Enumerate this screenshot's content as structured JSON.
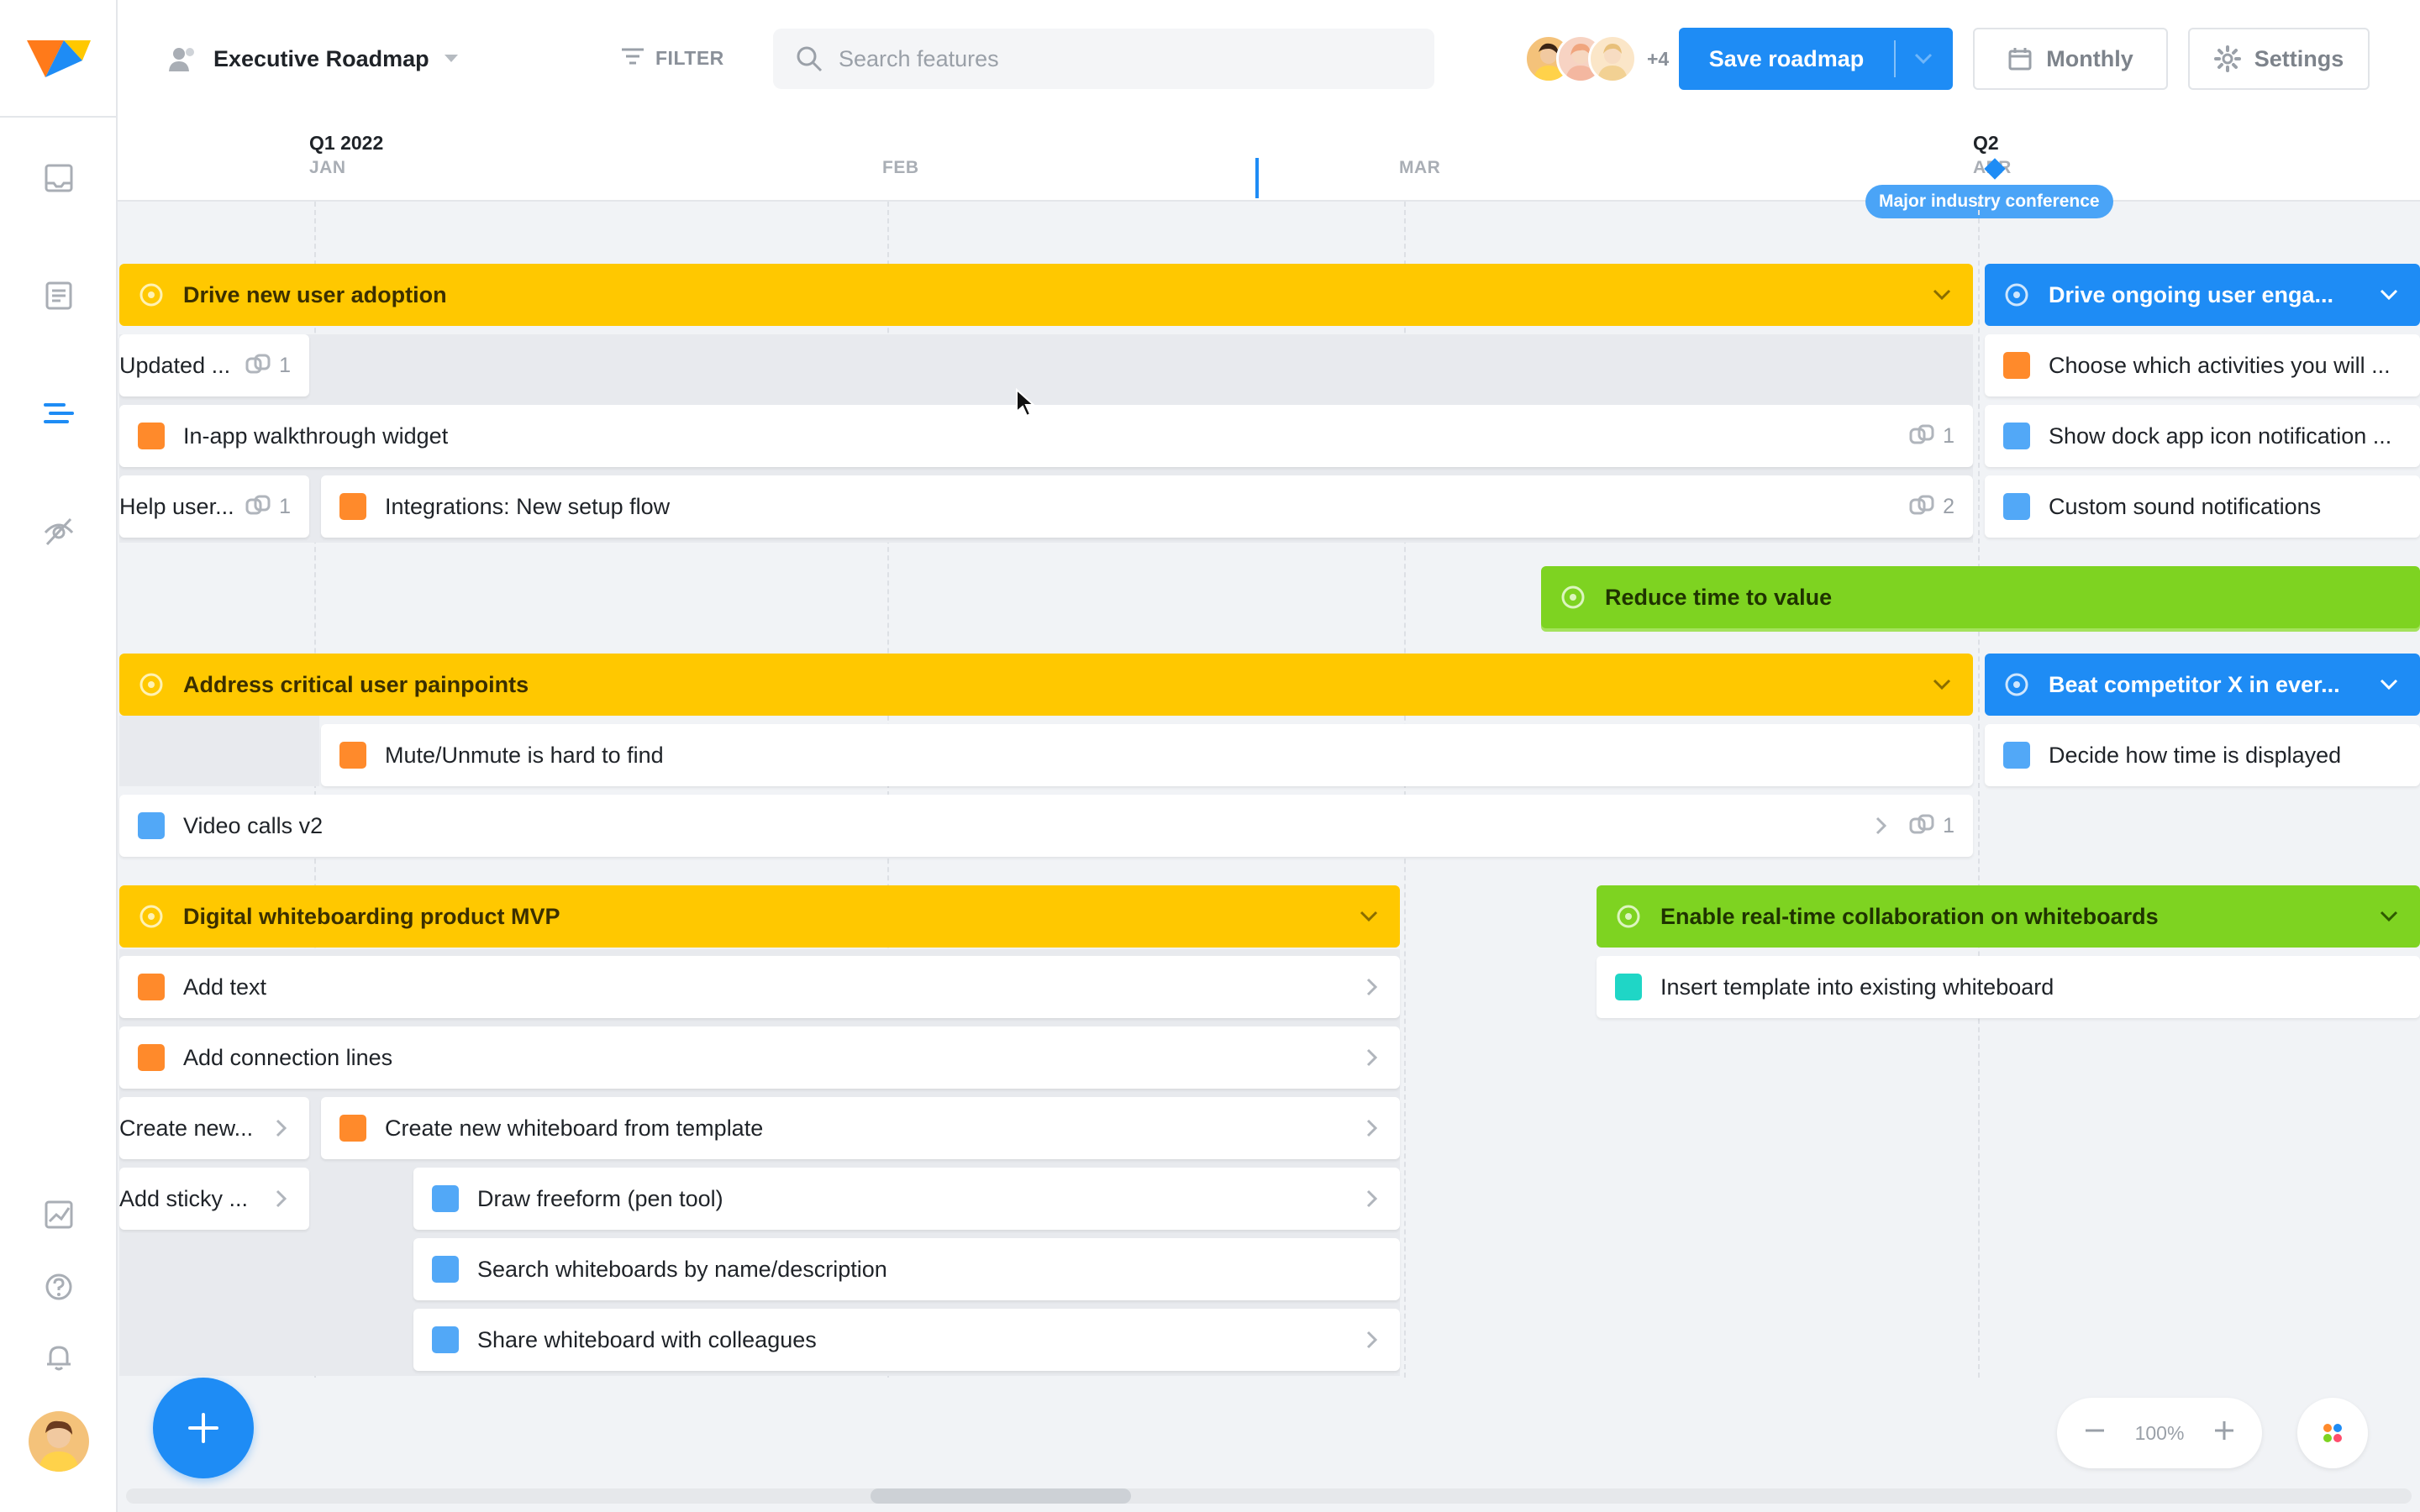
{
  "app": {
    "roadmap_name": "Executive Roadmap",
    "filter_label": "FILTER",
    "search_placeholder": "Search features",
    "avatars_more": "+4",
    "save_label": "Save roadmap",
    "view_label": "Monthly",
    "settings_label": "Settings",
    "accent_color": "#1e8cf5"
  },
  "sidebar": {
    "icons": [
      "logo-icon",
      "inbox-icon",
      "document-icon",
      "roadmap-icon",
      "hidden-eye-icon",
      "insights-icon",
      "help-icon",
      "bell-icon",
      "user-avatar"
    ]
  },
  "timeline": {
    "q1_label": "Q1 2022",
    "q2_label": "Q2",
    "months": [
      "JAN",
      "FEB",
      "MAR",
      "APR"
    ],
    "milestone": "Major industry conference"
  },
  "epics": {
    "drive_new": "Drive new user adoption",
    "drive_ongoing": "Drive ongoing user enga...",
    "reduce_time": "Reduce time to value",
    "address_pain": "Address critical user painpoints",
    "beat_competitor": "Beat competitor X in ever...",
    "whiteboard_mvp": "Digital whiteboarding product MVP",
    "realtime_collab": "Enable real-time collaboration on whiteboards"
  },
  "features": {
    "updated": {
      "label": "Updated ...",
      "links": "1"
    },
    "walkthrough": {
      "label": "In-app walkthrough widget",
      "links": "1"
    },
    "help_user": {
      "label": "Help user...",
      "links": "1"
    },
    "integrations": {
      "label": "Integrations: New setup flow",
      "links": "2"
    },
    "choose_activities": {
      "label": "Choose which activities you will ..."
    },
    "dock_icon": {
      "label": "Show dock app icon notification ..."
    },
    "custom_sound": {
      "label": "Custom sound notifications"
    },
    "mute_unmute": {
      "label": "Mute/Unmute is hard to find"
    },
    "decide_time": {
      "label": "Decide how time is displayed"
    },
    "video_calls": {
      "label": "Video calls v2",
      "links": "1"
    },
    "add_text": {
      "label": "Add text"
    },
    "add_lines": {
      "label": "Add connection lines"
    },
    "create_new_short": {
      "label": "Create new..."
    },
    "create_template": {
      "label": "Create new whiteboard from template"
    },
    "add_sticky": {
      "label": "Add sticky ..."
    },
    "draw_freeform": {
      "label": "Draw freeform (pen tool)"
    },
    "search_wb": {
      "label": "Search whiteboards by name/description"
    },
    "share_wb": {
      "label": "Share whiteboard with colleagues"
    },
    "insert_template": {
      "label": "Insert template into existing whiteboard"
    }
  },
  "colors": {
    "orange": "#ff8a2b",
    "blue": "#52a8f7",
    "teal": "#1fd6c6",
    "yellow_epic": "#ffc800",
    "blue_epic": "#1e8cf5",
    "green_epic": "#7ed321"
  },
  "zoom": {
    "level": "100%"
  }
}
